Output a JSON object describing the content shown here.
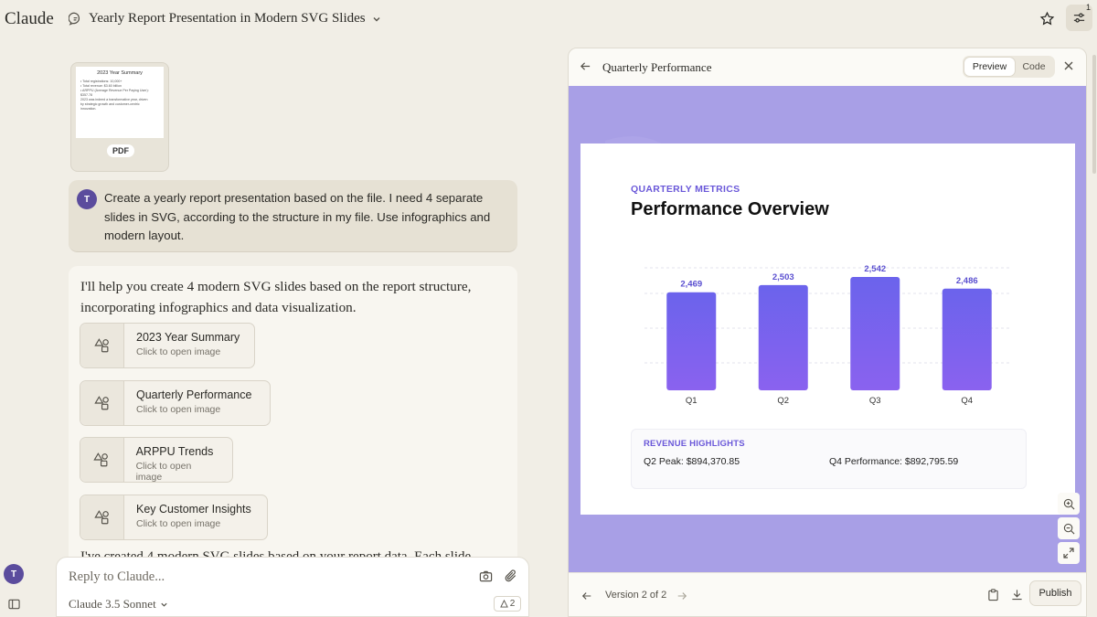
{
  "app": {
    "logo": "Claude",
    "chat_title": "Yearly Report Presentation in Modern SVG Slides",
    "settings_badge": "1"
  },
  "attachment": {
    "type_badge": "PDF",
    "preview_title": "2023 Year Summary",
    "preview_lines": [
      "• Total registrations: 10,000+",
      "• Total revenue: $3.60 billion",
      "• ARPPU (Average Revenue Per Paying User):",
      "  $357.78",
      "",
      "2023 was indeed a transformative year, driven",
      "by strategic growth and customer-centric",
      "innovation."
    ]
  },
  "user_message": {
    "avatar": "T",
    "text": "Create a yearly report presentation based on the file. I need 4 separate slides in SVG, according to the structure in my file. Use infographics and modern layout."
  },
  "assistant_message": {
    "intro": "I'll help you create 4 modern SVG slides based on the report structure, incorporating infographics and data visualization.",
    "artifacts": [
      {
        "title": "2023 Year Summary",
        "subtitle": "Click to open image"
      },
      {
        "title": "Quarterly Performance",
        "subtitle": "Click to open image"
      },
      {
        "title": "ARPPU Trends",
        "subtitle": "Click to open image"
      },
      {
        "title": "Key Customer Insights",
        "subtitle": "Click to open image"
      }
    ],
    "cut_text": "I've created 4 modern SVG slides based on your report data. Each slide"
  },
  "composer": {
    "placeholder": "Reply to Claude...",
    "model": "Claude 3.5 Sonnet",
    "style_count": "2"
  },
  "sidebar": {
    "avatar": "T"
  },
  "panel": {
    "title": "Quarterly Performance",
    "tabs": {
      "preview": "Preview",
      "code": "Code"
    },
    "version_label": "Version 2 of 2",
    "publish_label": "Publish"
  },
  "slide": {
    "eyebrow": "QUARTERLY METRICS",
    "title": "Performance Overview",
    "highlights": {
      "title": "REVENUE HIGHLIGHTS",
      "q2": "Q2 Peak: $894,370.85",
      "q4": "Q4 Performance: $892,795.59"
    }
  },
  "chart_data": {
    "type": "bar",
    "categories": [
      "Q1",
      "Q2",
      "Q3",
      "Q4"
    ],
    "values": [
      2469,
      2503,
      2542,
      2486
    ],
    "value_labels": [
      "2,469",
      "2,503",
      "2,542",
      "2,486"
    ],
    "ylim": [
      2000,
      2542
    ],
    "grid": true,
    "colors": {
      "bar_top": "#6b63ec",
      "bar_bottom": "#8a62ef"
    }
  },
  "colors": {
    "accent": "#6a58d9",
    "preview_bg": "#a89fe6",
    "avatar": "#5b4c9d"
  }
}
